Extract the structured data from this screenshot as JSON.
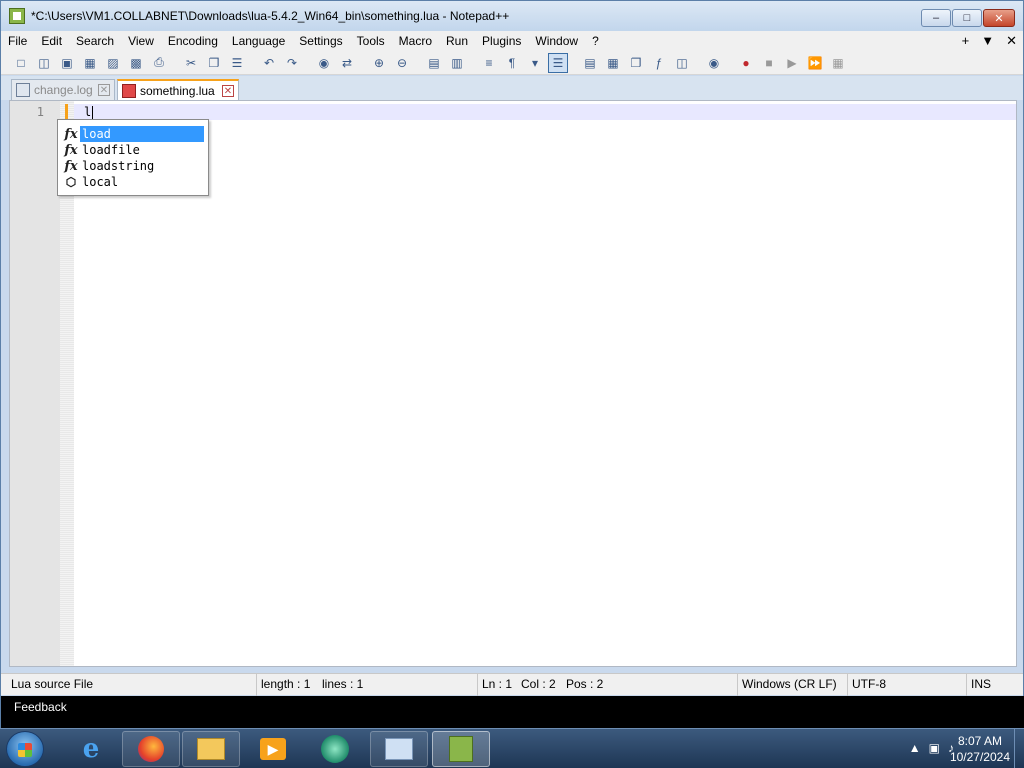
{
  "window": {
    "title": "*C:\\Users\\VM1.COLLABNET\\Downloads\\lua-5.4.2_Win64_bin\\something.lua - Notepad++",
    "minimize": "–",
    "maximize": "□",
    "close": "✕"
  },
  "menu": {
    "items": [
      "File",
      "Edit",
      "Search",
      "View",
      "Encoding",
      "Language",
      "Settings",
      "Tools",
      "Macro",
      "Run",
      "Plugins",
      "Window",
      "?"
    ],
    "right": [
      "+",
      "▼",
      "✕"
    ]
  },
  "tabs": [
    {
      "label": "change.log",
      "state": "inactive"
    },
    {
      "label": "something.lua",
      "state": "active"
    }
  ],
  "editor": {
    "line_number": "1",
    "code": "l"
  },
  "autocomplete": [
    {
      "icon": "fx",
      "label": "load",
      "selected": true
    },
    {
      "icon": "fx",
      "label": "loadfile",
      "selected": false
    },
    {
      "icon": "fx",
      "label": "loadstring",
      "selected": false
    },
    {
      "icon": "⬡",
      "label": "local",
      "selected": false
    }
  ],
  "status": {
    "file_type": "Lua source File",
    "length": "length : 1",
    "lines": "lines : 1",
    "ln": "Ln : 1",
    "col": "Col : 2",
    "pos": "Pos : 2",
    "eol": "Windows (CR LF)",
    "encoding": "UTF-8",
    "mode": "INS"
  },
  "feedback": "Feedback",
  "clock": {
    "time": "8:07 AM",
    "date": "10/27/2024"
  },
  "tray_icons": [
    "▲",
    "▣",
    "♪"
  ],
  "colors": {
    "accent_tab": "#f7a21b",
    "selection": "#3399ff",
    "taskbar": "#1e3654"
  }
}
